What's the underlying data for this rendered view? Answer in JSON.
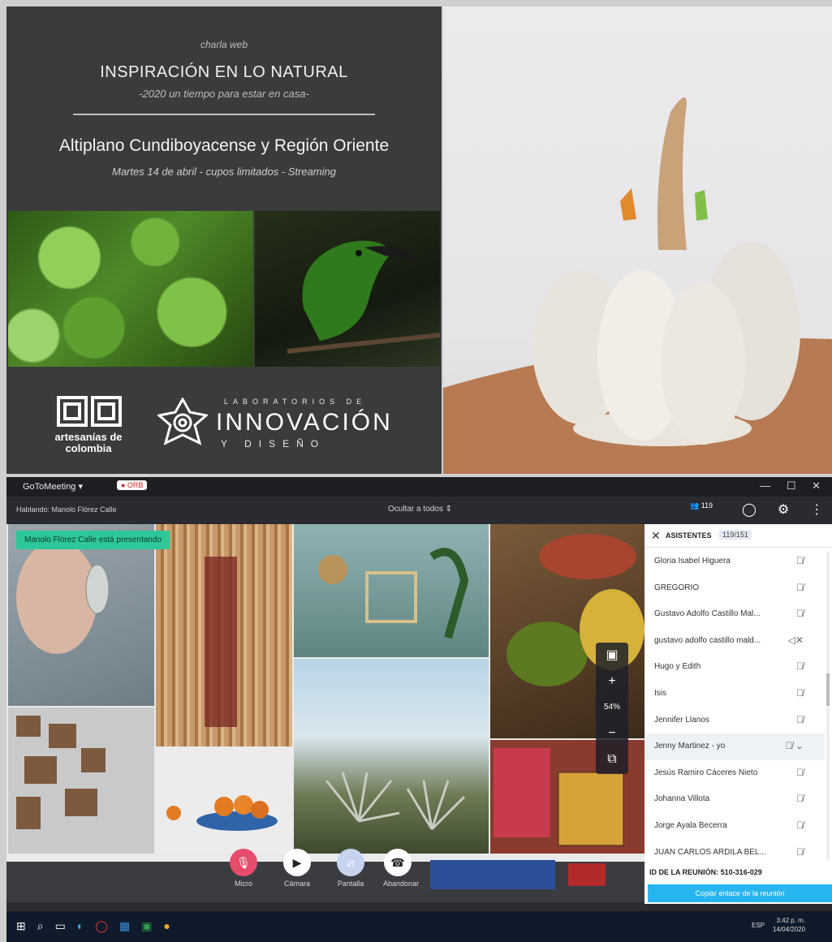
{
  "poster": {
    "kicker": "charla web",
    "title": "INSPIRACIÓN EN LO NATURAL",
    "tagline": "-2020 un tiempo para estar en casa-",
    "region": "Altiplano Cundiboyacense y Región Oriente",
    "date_line": "Martes 14 de abril - cupos limitados -  Streaming",
    "logo_left": "artesanías de colombia",
    "logo_right_top": "LABORATORIOS DE",
    "logo_right_main": "INNOVACIÓN",
    "logo_right_bottom": "Y DISEÑO"
  },
  "meeting": {
    "app_name": "GoToMeeting ▾",
    "rec_label": "● ORB",
    "window_controls": "— ☐ ✕",
    "speaking": "Hablando: Manolo Flórez Calle",
    "hide_all": "Ocultar a todos ⇕",
    "people_count": "119",
    "presenting": "Manolo Flórez Calle está presentando",
    "zoom_level": "54%"
  },
  "controls": {
    "mic": "Micro",
    "camera": "Cámara",
    "screen": "Pantalla",
    "leave": "Abandonar"
  },
  "attendees": {
    "title": "ASISTENTES",
    "count": "119/151",
    "items": [
      {
        "name": "Gloria Isabel Higuera",
        "icon": "mic-off-icon",
        "glyph": "🎙̸"
      },
      {
        "name": "GREGORIO",
        "icon": "mic-off-icon",
        "glyph": "🎙̸"
      },
      {
        "name": "Gustavo Adolfo Castillo Mal...",
        "icon": "mic-off-icon",
        "glyph": "🎙̸"
      },
      {
        "name": "gustavo adolfo castillo mald...",
        "icon": "speaker-off-icon",
        "glyph": "◁✕"
      },
      {
        "name": "Hugo y Edith",
        "icon": "mic-off-icon",
        "glyph": "🎙̸"
      },
      {
        "name": "Isis",
        "icon": "mic-off-icon",
        "glyph": "🎙̸"
      },
      {
        "name": "Jennifer Llanos",
        "icon": "mic-off-icon",
        "glyph": "🎙̸"
      },
      {
        "name": "Jenny Martinez  - yo",
        "icon": "mic-off-icon",
        "glyph": "🎙̸ ⌄"
      },
      {
        "name": "Jesús Ramiro Cáceres Nieto",
        "icon": "mic-off-icon",
        "glyph": "🎙̸"
      },
      {
        "name": "Johanna Villota",
        "icon": "mic-off-icon",
        "glyph": "🎙̸"
      },
      {
        "name": "Jorge Ayala Becerra",
        "icon": "mic-off-icon",
        "glyph": "🎙̸"
      },
      {
        "name": "JUAN CARLOS ARDILA  BEL...",
        "icon": "mic-off-icon",
        "glyph": "🎙̸"
      }
    ],
    "meeting_id": "ID DE LA REUNIÓN:  510-316-029",
    "copy_link": "Copiar enlace de la reunión"
  },
  "taskbar": {
    "lang": "ESP",
    "time": "3:42 p. m.",
    "date": "14/04/2020"
  },
  "colors": {
    "poster_bg": "#3b3b3b",
    "presenting_badge": "#2ec79a",
    "copy_link_button": "#27b5ef",
    "mic_button": "#e84c6d"
  }
}
